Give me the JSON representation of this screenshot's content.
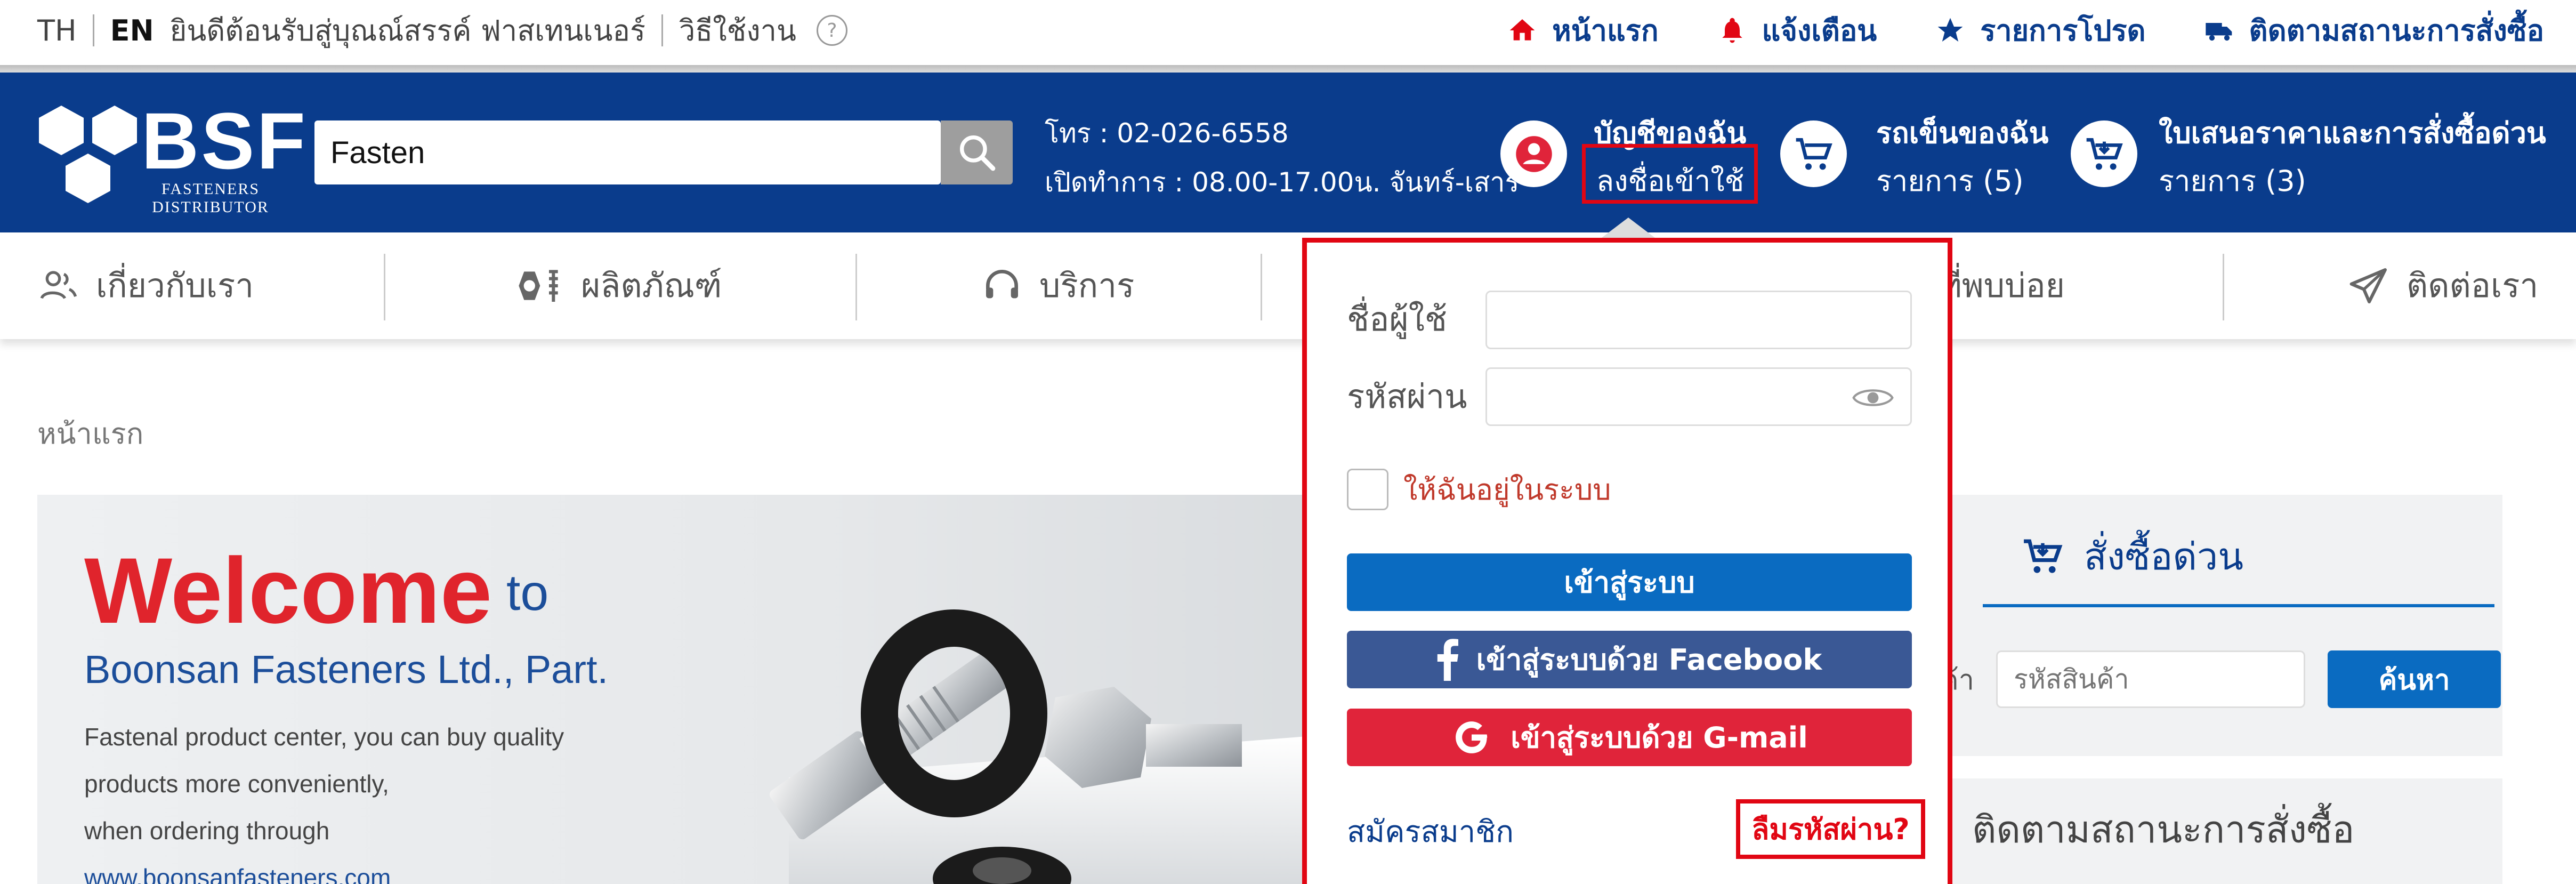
{
  "topbar": {
    "lang_th": "TH",
    "lang_en": "EN",
    "welcome": "ยินดีต้อนรับสู่บุณณ์สรรค์ ฟาสเทนเนอร์",
    "howto": "วิธีใช้งาน",
    "help_glyph": "?",
    "links": [
      {
        "label": "หน้าแรก",
        "icon": "home-icon"
      },
      {
        "label": "แจ้งเตือน",
        "icon": "bell-icon"
      },
      {
        "label": "รายการโปรด",
        "icon": "star-icon"
      },
      {
        "label": "ติดตามสถานะการสั่งซื้อ",
        "icon": "truck-icon"
      }
    ]
  },
  "header": {
    "logo_word": "BSF",
    "logo_tag_1": "FASTENERS",
    "logo_tag_2": "DISTRIBUTOR",
    "search_value": "Fasten",
    "phone": "โทร : 02-026-6558",
    "hours": "เปิดทำการ : 08.00-17.00น. จันทร์-เสาร์",
    "account_title": "บัญชีของฉัน",
    "account_link": "ลงชื่อเข้าใช้",
    "cart_title": "รถเข็นของฉัน",
    "cart_items": "รายการ (5)",
    "quote_title": "ใบเสนอราคาและการสั่งซื้อด่วน",
    "quote_items": "รายการ (3)"
  },
  "nav": {
    "about": "เกี่ยวกับเรา",
    "products": "ผลิตภัณฑ์",
    "services": "บริการ",
    "faq": "ที่พบบ่อย",
    "contact": "ติดต่อเรา"
  },
  "breadcrumb": "หน้าแรก",
  "banner": {
    "welcome": "Welcome",
    "to": "to",
    "company": "Boonsan Fasteners Ltd., Part.",
    "line1": "Fastenal product center, you can buy quality",
    "line2": "products more conveniently,",
    "line3": "when ordering through",
    "url": "www.boonsanfasteners.com"
  },
  "quick_order": {
    "title": "สั่งซื้อด่วน",
    "field_label_tail": "ค้า",
    "placeholder": "รหัสสินค้า",
    "search_button": "ค้นหา"
  },
  "track_order": {
    "title": "ติดตามสถานะการสั่งซื้อ"
  },
  "login_popup": {
    "username_label": "ชื่อผู้ใช้",
    "password_label": "รหัสผ่าน",
    "username_value": "",
    "password_value": "",
    "remember": "ให้ฉันอยู่ในระบบ",
    "login_button": "เข้าสู่ระบบ",
    "facebook_button": "เข้าสู่ระบบด้วย Facebook",
    "gmail_button": "เข้าสู่ระบบด้วย G-mail",
    "register": "สมัครสมาชิก",
    "forgot": "ลืมรหัสผ่าน?"
  },
  "colors": {
    "brand_blue": "#0a3c8c",
    "button_blue": "#0a6bc1",
    "facebook": "#3a5895",
    "gmail": "#e0243a",
    "highlight_red": "#e10613"
  }
}
